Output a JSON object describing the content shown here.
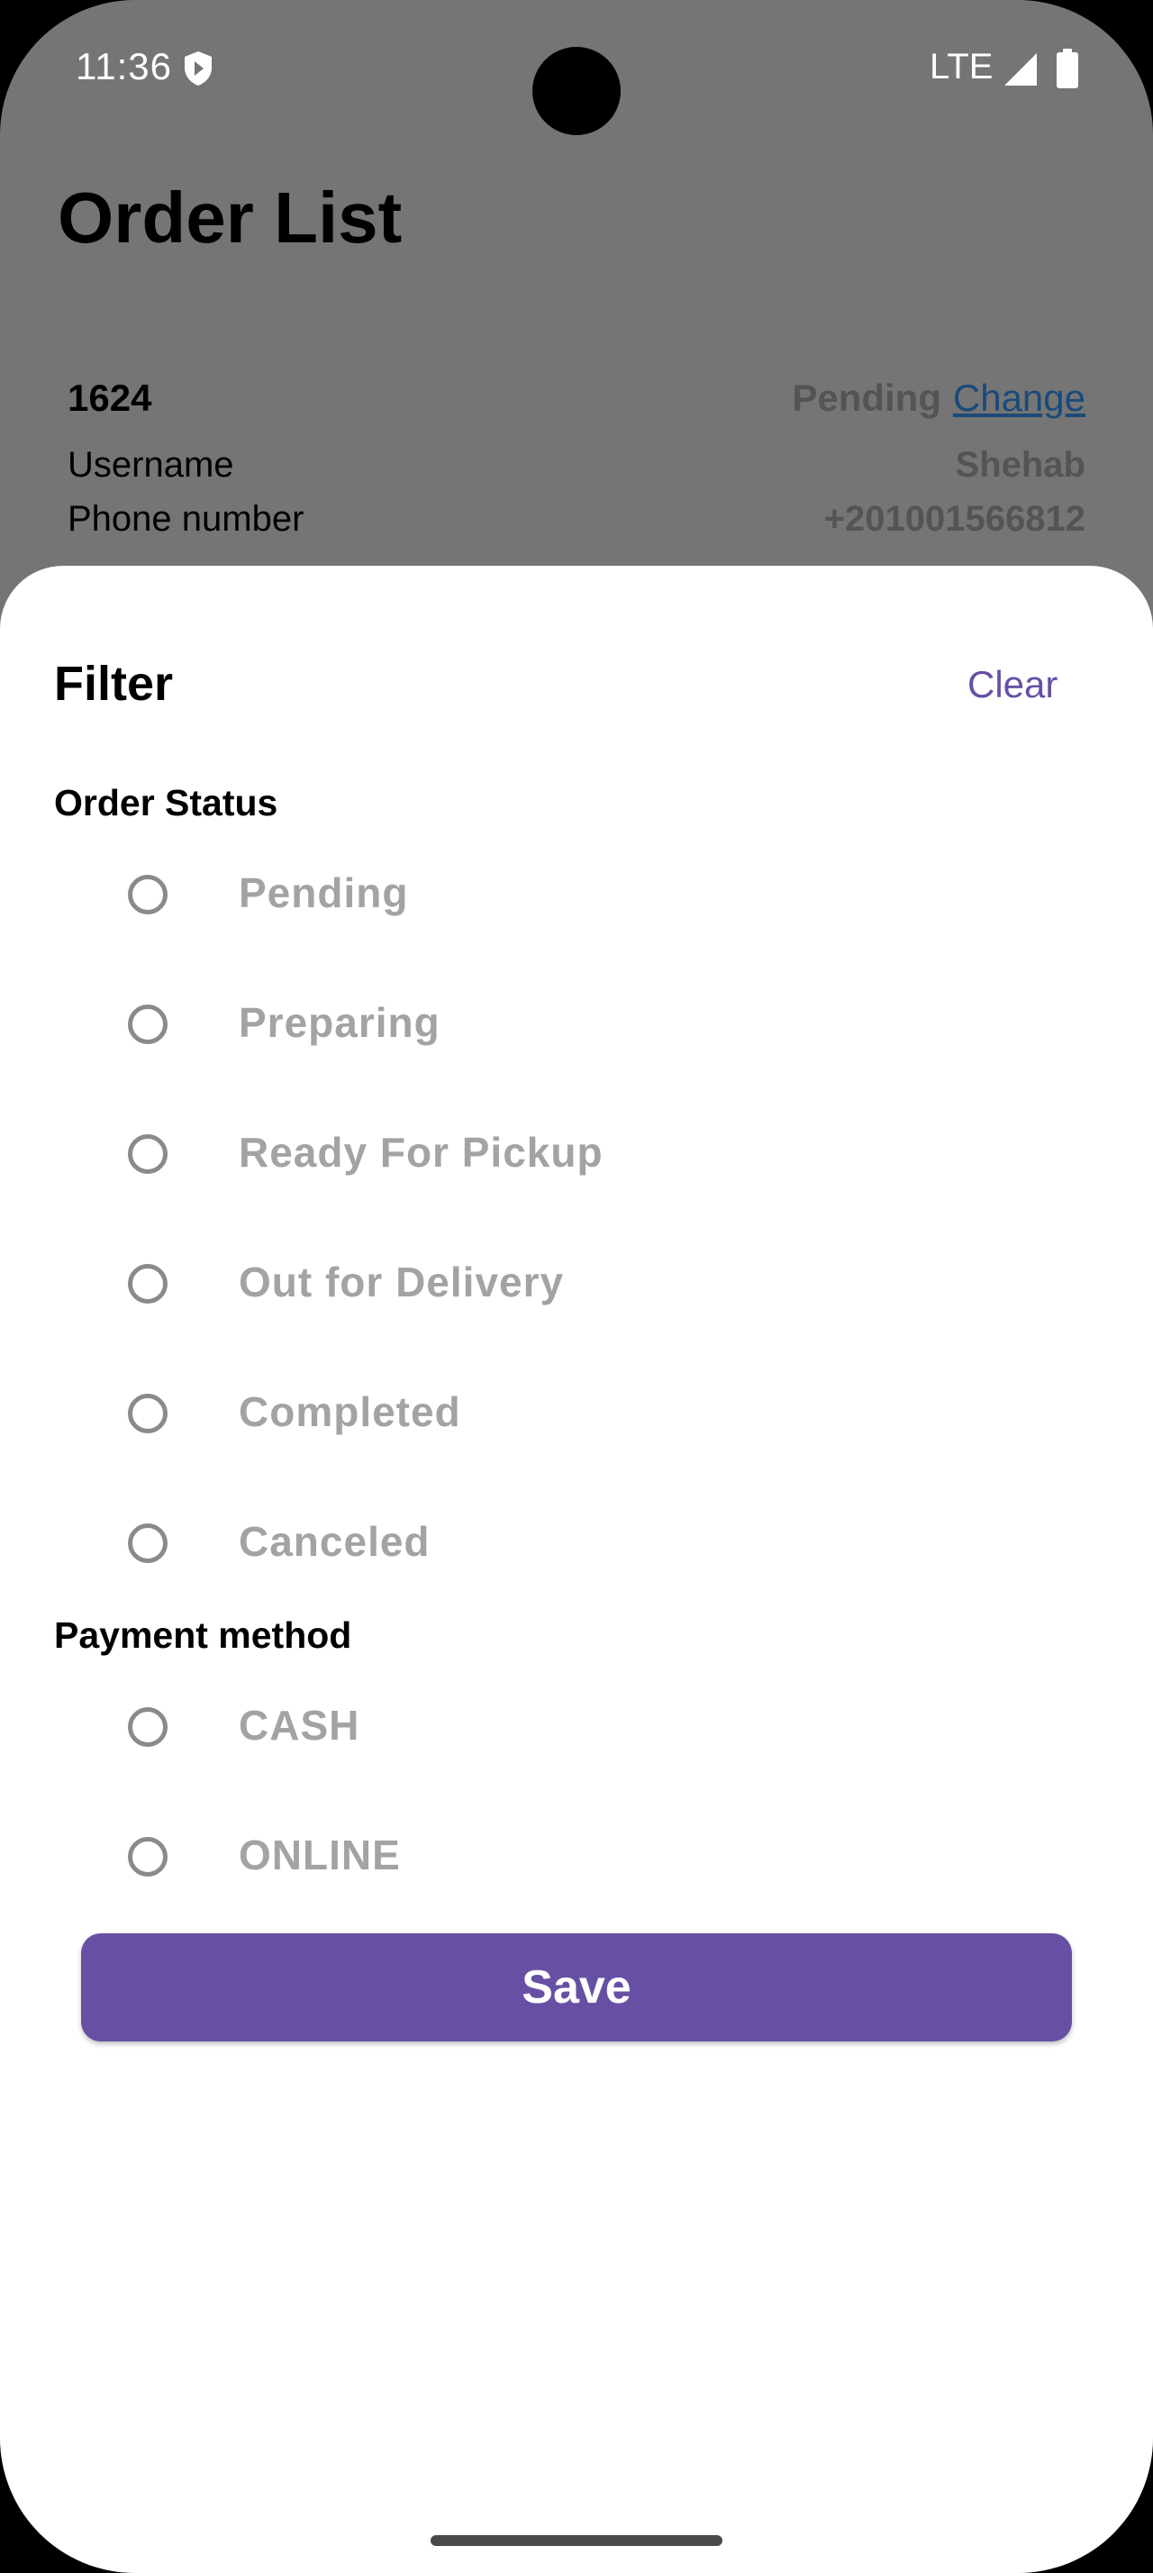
{
  "status_bar": {
    "time": "11:36",
    "network": "LTE",
    "icons": [
      "shield-icon",
      "signal-icon",
      "battery-icon"
    ]
  },
  "page": {
    "title": "Order List",
    "order": {
      "id": "1624",
      "status": "Pending",
      "change_label": "Change",
      "rows": [
        {
          "label": "Username",
          "value": "Shehab"
        },
        {
          "label": "Phone number",
          "value": "+201001566812"
        }
      ]
    }
  },
  "filter_sheet": {
    "title": "Filter",
    "clear_label": "Clear",
    "order_status": {
      "label": "Order Status",
      "options": [
        "Pending",
        "Preparing",
        "Ready For Pickup",
        "Out for Delivery",
        "Completed",
        "Canceled"
      ]
    },
    "payment_method": {
      "label": "Payment method",
      "options": [
        "CASH",
        "ONLINE"
      ]
    },
    "save_label": "Save"
  },
  "colors": {
    "accent": "#6750a4",
    "scrim": "#757575",
    "radio_unselected": "#8a8a8a",
    "option_text": "#a3a3a3",
    "link": "#1a4a7a"
  }
}
